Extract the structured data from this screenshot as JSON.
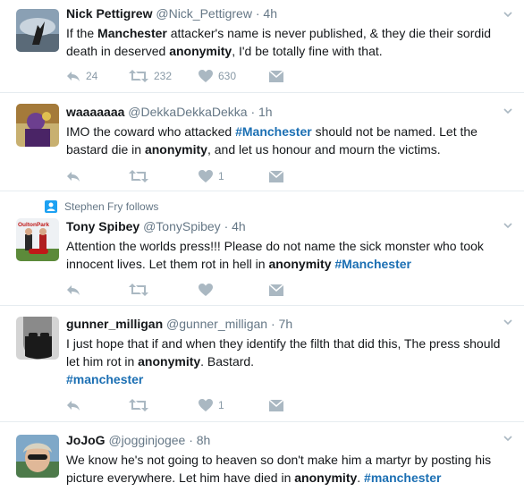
{
  "tweets": [
    {
      "fullname": "Nick Pettigrew",
      "username": "@Nick_Pettigrew",
      "sep": "·",
      "time": "4h",
      "text_parts": [
        {
          "t": "If the "
        },
        {
          "t": "Manchester",
          "b": true
        },
        {
          "t": " attacker's name is never published, & they die their sordid death in deserved "
        },
        {
          "t": "anonymity",
          "b": true
        },
        {
          "t": ", I'd be totally fine with that."
        }
      ],
      "replies": "24",
      "retweets": "232",
      "likes": "630"
    },
    {
      "fullname": "waaaaaaa",
      "username": "@DekkaDekkaDekka",
      "sep": "·",
      "time": "1h",
      "text_parts": [
        {
          "t": "IMO the coward who attacked "
        },
        {
          "t": "#Manchester",
          "tag": true
        },
        {
          "t": " should not be named. Let the bastard die in "
        },
        {
          "t": "anonymity",
          "b": true
        },
        {
          "t": ", and let us honour and mourn the victims."
        }
      ],
      "replies": "",
      "retweets": "",
      "likes": "1"
    },
    {
      "context": "Stephen Fry follows",
      "fullname": "Tony Spibey",
      "username": "@TonySpibey",
      "sep": "·",
      "time": "4h",
      "avatar_text": "OultonPark",
      "text_parts": [
        {
          "t": "Attention the worlds press!!! Please do not name the sick monster who took innocent lives. Let them rot in hell in "
        },
        {
          "t": "anonymity",
          "b": true
        },
        {
          "t": " "
        },
        {
          "t": "#Manchester",
          "tag": true
        }
      ],
      "replies": "",
      "retweets": "",
      "likes": ""
    },
    {
      "fullname": "gunner_milligan",
      "username": "@gunner_milligan",
      "sep": "·",
      "time": "7h",
      "text_parts": [
        {
          "t": "I just hope that if and when they identify the filth that did this, The press should let him rot in "
        },
        {
          "t": "anonymity",
          "b": true
        },
        {
          "t": ".  Bastard."
        },
        {
          "br": true
        },
        {
          "t": "#manchester",
          "tag": true
        }
      ],
      "replies": "",
      "retweets": "",
      "likes": "1"
    },
    {
      "fullname": "JoJoG",
      "username": "@jogginjogee",
      "sep": "·",
      "time": "8h",
      "text_parts": [
        {
          "t": "We know he's not going to heaven so don't make him a martyr by posting his picture everywhere. Let him have died in "
        },
        {
          "t": "anonymity",
          "b": true
        },
        {
          "t": ". "
        },
        {
          "t": "#manchester",
          "tag": true
        }
      ],
      "replies": "",
      "retweets": "",
      "likes": ""
    }
  ],
  "colors": {
    "link": "#1b6fb3",
    "icon": "#aab8c2",
    "muted": "#657786",
    "border": "#e6ecf0",
    "context_icon": "#1da1f2"
  },
  "icons": {
    "reply": "reply-icon",
    "retweet": "retweet-icon",
    "like": "heart-icon",
    "dm": "envelope-icon",
    "caret": "chevron-down-icon",
    "follow": "person-icon"
  }
}
